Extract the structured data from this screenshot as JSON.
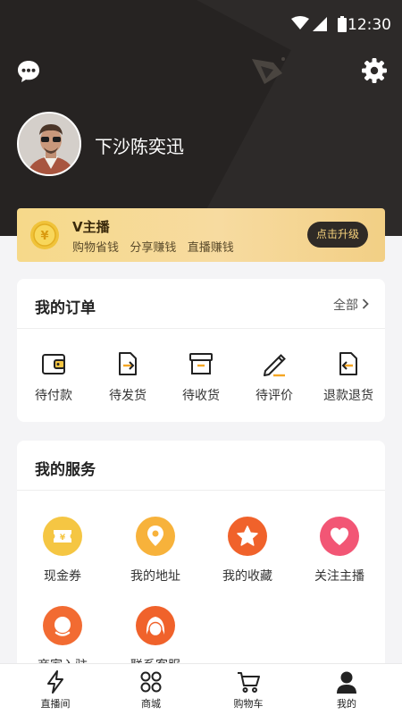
{
  "status_bar": {
    "time": "12:30"
  },
  "profile": {
    "username": "下沙陈奕迅"
  },
  "vip": {
    "title": "V主播",
    "subtitle": "购物省钱   分享赚钱   直播赚钱",
    "upgrade_label": "点击升级",
    "coin_symbol": "¥"
  },
  "orders": {
    "title": "我的订单",
    "see_all_label": "全部",
    "items": [
      {
        "label": "待付款",
        "icon": "wallet-icon"
      },
      {
        "label": "待发货",
        "icon": "ship-out-icon"
      },
      {
        "label": "待收货",
        "icon": "box-icon"
      },
      {
        "label": "待评价",
        "icon": "pen-icon"
      },
      {
        "label": "退款退货",
        "icon": "refund-icon"
      }
    ]
  },
  "services": {
    "title": "我的服务",
    "items": [
      {
        "label": "现金券",
        "icon": "coupon-icon",
        "color": "#f5c643"
      },
      {
        "label": "我的地址",
        "icon": "location-icon",
        "color": "#f7b23b"
      },
      {
        "label": "我的收藏",
        "icon": "star-icon",
        "color": "#f0622b"
      },
      {
        "label": "关注主播",
        "icon": "heart-icon",
        "color": "#f25675"
      },
      {
        "label": "商家入驻",
        "icon": "merchant-icon",
        "color": "#f26b32"
      },
      {
        "label": "联系客服",
        "icon": "customer-service-icon",
        "color": "#f0622b"
      }
    ]
  },
  "tabbar": {
    "items": [
      {
        "label": "直播间",
        "icon": "lightning-icon",
        "active": false
      },
      {
        "label": "商城",
        "icon": "grid-icon",
        "active": false
      },
      {
        "label": "购物车",
        "icon": "cart-icon",
        "active": false
      },
      {
        "label": "我的",
        "icon": "person-icon",
        "active": true
      }
    ]
  },
  "colors": {
    "header_bg": "#2d2a29",
    "vip_gold": "#f6d98a",
    "vip_button_bg": "#2f2a26",
    "vip_button_text": "#f5d17b",
    "page_bg": "#f4f4f6"
  }
}
